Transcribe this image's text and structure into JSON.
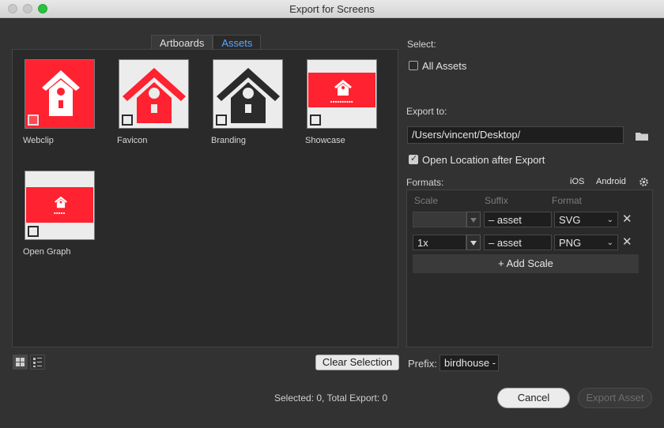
{
  "window": {
    "title": "Export for Screens"
  },
  "tabs": [
    {
      "label": "Artboards",
      "active": false
    },
    {
      "label": "Assets",
      "active": true
    }
  ],
  "assets": [
    {
      "label": "Webclip",
      "selected": false
    },
    {
      "label": "Favicon",
      "selected": false
    },
    {
      "label": "Branding",
      "selected": false
    },
    {
      "label": "Showcase",
      "selected": false
    },
    {
      "label": "Open Graph",
      "selected": false
    }
  ],
  "grid_panel": {
    "clear_selection_label": "Clear Selection"
  },
  "select_section": {
    "title": "Select:",
    "all_assets_label": "All Assets",
    "all_assets_checked": false
  },
  "export_to": {
    "title": "Export to:",
    "path": "/Users/vincent/Desktop/",
    "open_location_label": "Open Location after Export",
    "open_location_checked": true
  },
  "formats": {
    "title": "Formats:",
    "ios_label": "iOS",
    "android_label": "Android",
    "columns": [
      "Scale",
      "Suffix",
      "Format"
    ],
    "rows": [
      {
        "scale": "",
        "suffix": "– asset",
        "format": "SVG"
      },
      {
        "scale": "1x",
        "suffix": "– asset",
        "format": "PNG"
      }
    ],
    "add_scale_label": "+ Add Scale"
  },
  "prefix": {
    "label": "Prefix:",
    "value": "birdhouse -"
  },
  "footer": {
    "status": "Selected: 0, Total Export: 0",
    "cancel_label": "Cancel",
    "export_label": "Export Asset"
  },
  "colors": {
    "brand_red": "#ff2230",
    "link_blue": "#5aa8ff"
  }
}
